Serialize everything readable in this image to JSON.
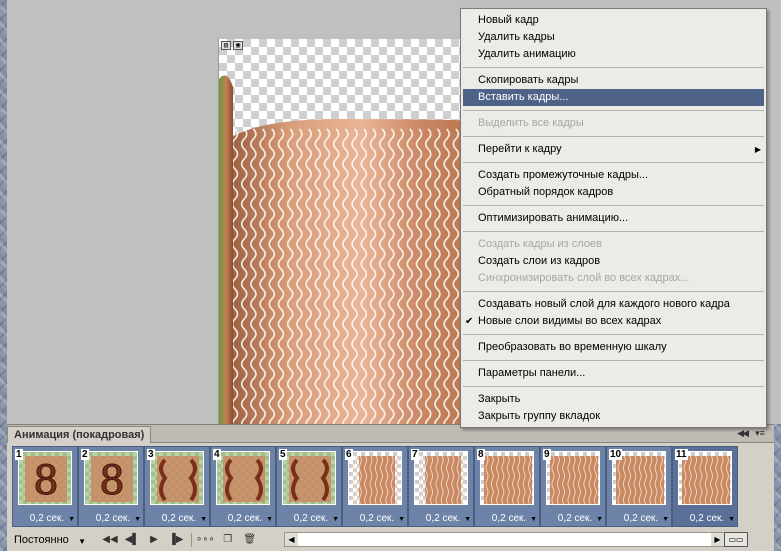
{
  "document": {
    "toolbar_icons": [
      "ruler-icon",
      "frame-icon"
    ]
  },
  "animation_panel": {
    "title": "Анимация (покадровая)",
    "frames": [
      {
        "number": "1",
        "delay": "0,2 сек.",
        "thumb": "figure-8"
      },
      {
        "number": "2",
        "delay": "0,2 сек.",
        "thumb": "figure-8"
      },
      {
        "number": "3",
        "delay": "0,2 сек.",
        "thumb": "figure-8-split"
      },
      {
        "number": "4",
        "delay": "0,2 сек.",
        "thumb": "figure-8-split"
      },
      {
        "number": "5",
        "delay": "0,2 сек.",
        "thumb": "figure-8-split"
      },
      {
        "number": "6",
        "delay": "0,2 сек.",
        "thumb": "wave-strip"
      },
      {
        "number": "7",
        "delay": "0,2 сек.",
        "thumb": "wave-strip"
      },
      {
        "number": "8",
        "delay": "0,2 сек.",
        "thumb": "wave"
      },
      {
        "number": "9",
        "delay": "0,2 сек.",
        "thumb": "wave"
      },
      {
        "number": "10",
        "delay": "0,2 сек.",
        "thumb": "wave"
      },
      {
        "number": "11",
        "delay": "0,2 сек.",
        "thumb": "wave"
      }
    ],
    "loop_value": "Постоянно",
    "selected_frame": "11"
  },
  "context_menu": {
    "items": [
      {
        "label": "Новый кадр",
        "disabled": false
      },
      {
        "label": "Удалить кадры",
        "disabled": false
      },
      {
        "label": "Удалить анимацию",
        "disabled": false
      },
      {
        "separator": true
      },
      {
        "label": "Скопировать кадры",
        "disabled": false
      },
      {
        "label": "Вставить кадры...",
        "disabled": false,
        "highlighted": true
      },
      {
        "separator": true
      },
      {
        "label": "Выделить все кадры",
        "disabled": true
      },
      {
        "separator": true
      },
      {
        "label": "Перейти к кадру",
        "disabled": false,
        "submenu": true
      },
      {
        "separator": true
      },
      {
        "label": "Создать промежуточные кадры...",
        "disabled": false
      },
      {
        "label": "Обратный порядок кадров",
        "disabled": false
      },
      {
        "separator": true
      },
      {
        "label": "Оптимизировать анимацию...",
        "disabled": false
      },
      {
        "separator": true
      },
      {
        "label": "Создать кадры из слоев",
        "disabled": true
      },
      {
        "label": "Создать слои из кадров",
        "disabled": false
      },
      {
        "label": "Синхронизировать слой во всех кадрах...",
        "disabled": true
      },
      {
        "separator": true
      },
      {
        "label": "Создавать новый слой для каждого нового кадра",
        "disabled": false
      },
      {
        "label": "Новые слои видимы во всех кадрах",
        "disabled": false,
        "checked": true
      },
      {
        "separator": true
      },
      {
        "label": "Преобразовать во временную шкалу",
        "disabled": false
      },
      {
        "separator": true
      },
      {
        "label": "Параметры панели...",
        "disabled": false
      },
      {
        "separator": true
      },
      {
        "label": "Закрыть",
        "disabled": false
      },
      {
        "label": "Закрыть группу вкладок",
        "disabled": false
      }
    ]
  },
  "colors": {
    "highlight": "#4e6387",
    "frame_bg": "#6d84a8",
    "copper": "#c98a63"
  }
}
